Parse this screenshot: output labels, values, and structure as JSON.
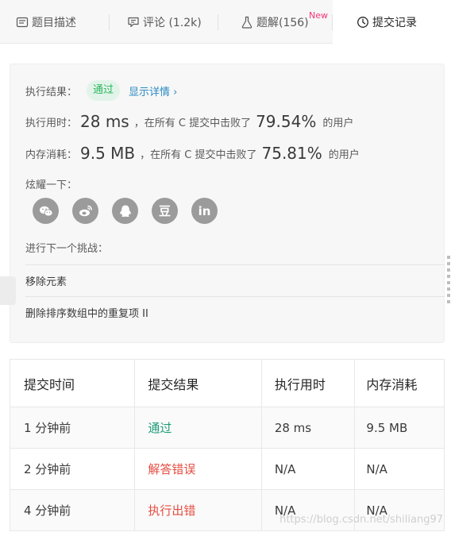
{
  "tabs": [
    {
      "label": "题目描述",
      "icon": "description-icon"
    },
    {
      "label": "评论 (1.2k)",
      "icon": "comment-icon"
    },
    {
      "label": "题解(156)",
      "icon": "flask-icon",
      "badge": "New"
    },
    {
      "label": "提交记录",
      "icon": "clock-icon",
      "active": true
    }
  ],
  "result": {
    "label": "执行结果：",
    "status": "通过",
    "detail_link": "显示详情 ›",
    "time_label": "执行用时：",
    "time_value": "28 ms",
    "time_mid": "，在所有 C 提交中击败了",
    "time_pct": "79.54%",
    "time_tail": "的用户",
    "mem_label": "内存消耗：",
    "mem_value": "9.5 MB",
    "mem_mid": "，在所有 C 提交中击败了",
    "mem_pct": "75.81%",
    "mem_tail": "的用户",
    "share_label": "炫耀一下：",
    "share_icons": [
      "wechat-icon",
      "weibo-icon",
      "qq-icon",
      "douban-icon",
      "linkedin-icon"
    ],
    "douban_glyph": "豆",
    "linkedin_glyph": "in",
    "next_label": "进行下一个挑战：",
    "next_items": [
      "移除元素",
      "删除排序数组中的重复项 II"
    ]
  },
  "table": {
    "headers": [
      "提交时间",
      "提交结果",
      "执行用时",
      "内存消耗"
    ],
    "rows": [
      {
        "time": "1 分钟前",
        "result": "通过",
        "runtime": "28 ms",
        "memory": "9.5 MB"
      },
      {
        "time": "2 分钟前",
        "result": "解答错误",
        "runtime": "N/A",
        "memory": "N/A"
      },
      {
        "time": "4 分钟前",
        "result": "执行出错",
        "runtime": "N/A",
        "memory": "N/A"
      }
    ]
  },
  "watermark": "https://blog.csdn.net/shiliang97",
  "colors": {
    "pass": "#2db55d",
    "error": "#e54d42",
    "link": "#2a8ac2",
    "badge_new": "#f5357a"
  }
}
